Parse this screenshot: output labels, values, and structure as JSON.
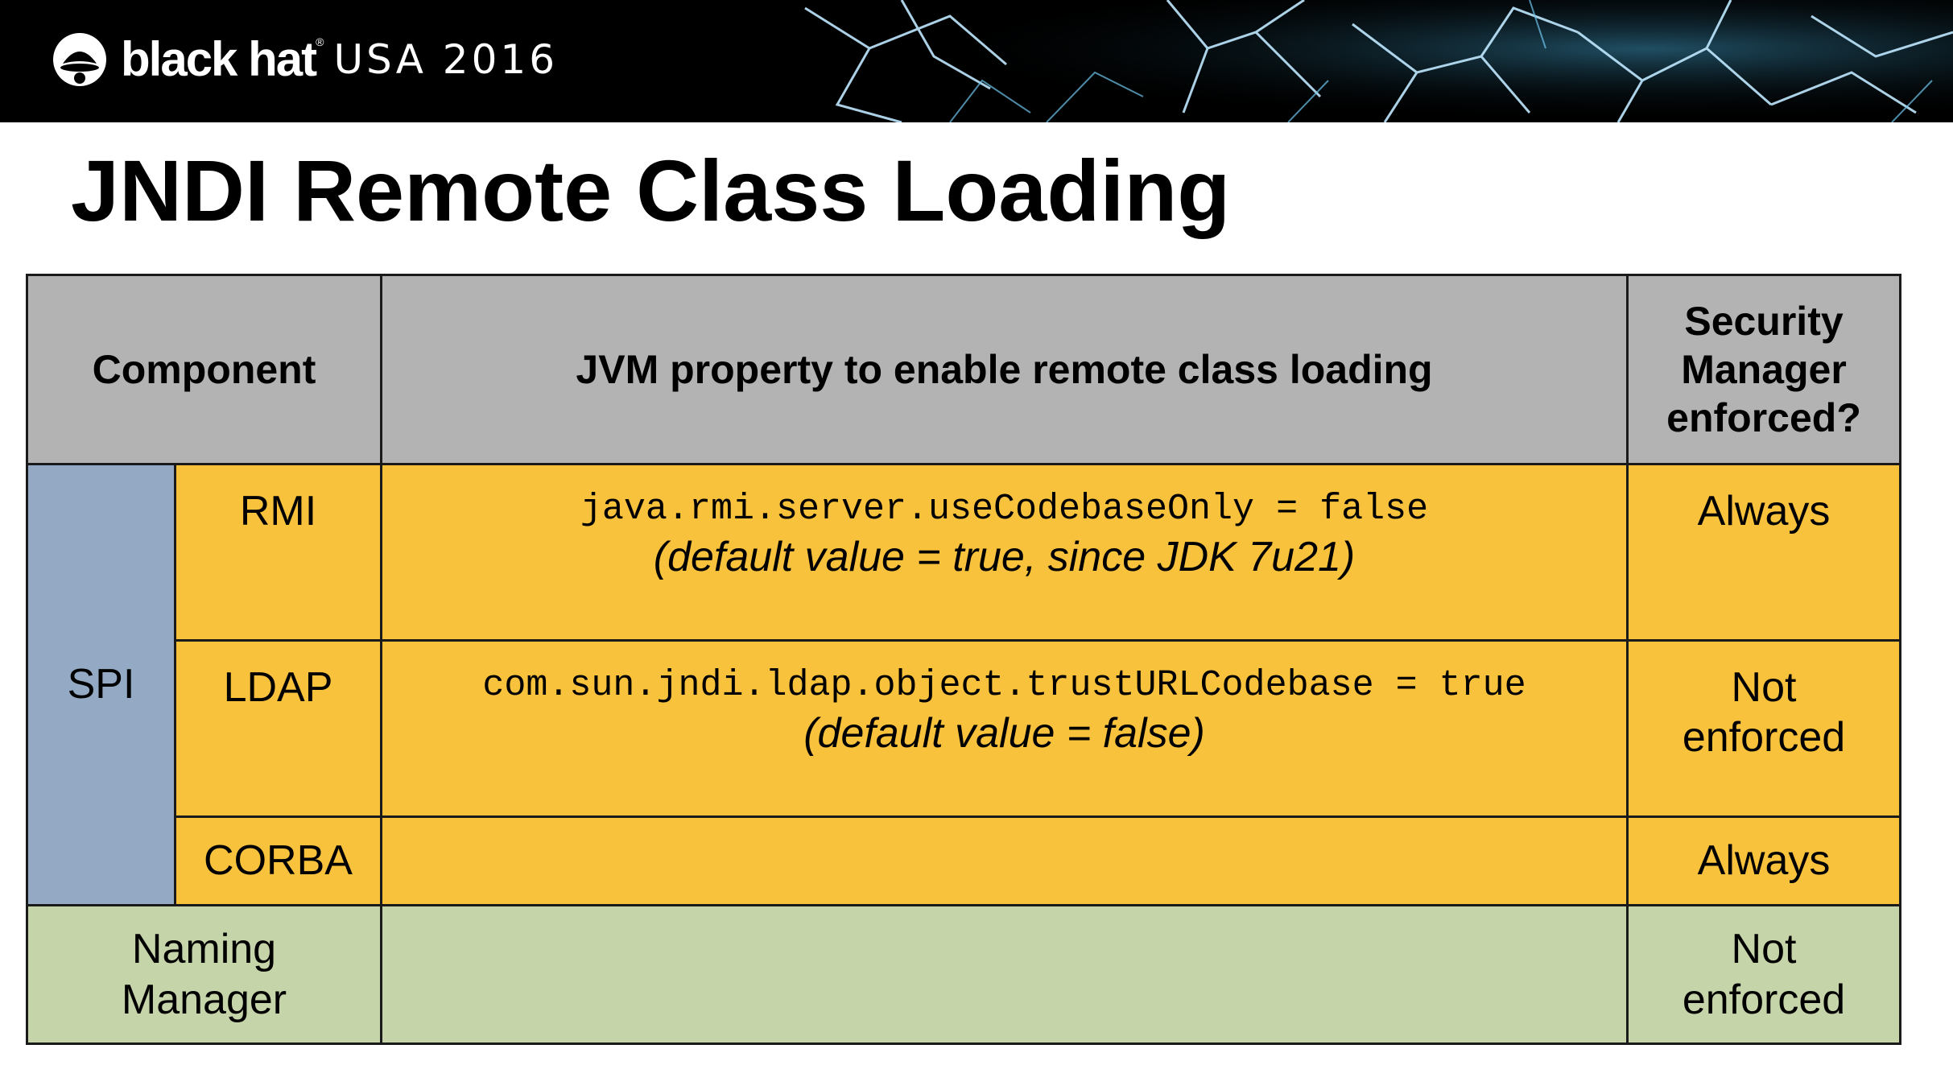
{
  "banner": {
    "brand": "black hat",
    "registered_mark": "®",
    "event": "USA 2016"
  },
  "title": "JNDI Remote Class Loading",
  "table": {
    "headers": {
      "component": "Component",
      "property": "JVM property to enable remote class loading",
      "security": "Security Manager enforced?"
    },
    "spi_label": "SPI",
    "rows": [
      {
        "component": "RMI",
        "property": "java.rmi.server.useCodebaseOnly = false",
        "note": "(default value = true, since JDK 7u21)",
        "security": "Always"
      },
      {
        "component": "LDAP",
        "property": "com.sun.jndi.ldap.object.trustURLCodebase = true",
        "note": "(default value = false)",
        "security": "Not enforced"
      },
      {
        "component": "CORBA",
        "property": "",
        "note": "",
        "security": "Always"
      }
    ],
    "naming": {
      "component": "Naming Manager",
      "property": "",
      "security": "Not enforced"
    }
  },
  "colors": {
    "header_bg": "#b3b3b3",
    "spi_bg": "#94a9c4",
    "sub_bg": "#f9c23c",
    "naming_bg": "#c6d4a9",
    "banner_bg": "#000000"
  },
  "icons": {
    "logo": "hat-silhouette-icon",
    "banner_art": "shattered-glass-graphic"
  }
}
